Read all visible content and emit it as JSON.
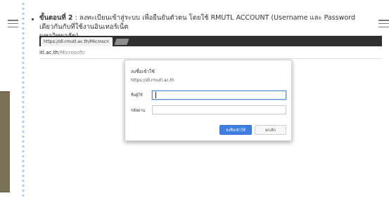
{
  "instruction": {
    "step_label": "ขั้นตอนที่ 2",
    "text_line1": " : ลงทะเบียนเข้าสู่ระบบ เพื่อยืนยันตัวตน โดยใช้ RMUTL ACCOUNT (Username และ Password เดียวกันกับที่ใช้งานอินเทอร์เน็ต",
    "text_line2": "มหาวิทยาลัย)"
  },
  "browser": {
    "tab_title": "https://dl.rmutl.ac.th/Microsc",
    "tab_close": "×",
    "url_host": "itl.ac.th",
    "url_path": "/Microsoft/"
  },
  "dialog": {
    "title": "ลงชื่อเข้าใช้",
    "site": "https://dl.rmutl.ac.th",
    "username_label": "ชื่อผู้ใช้",
    "username_value": "",
    "password_label": "รหัสผ่าน",
    "password_value": "",
    "login_button": "ลงชื่อเข้าใช้",
    "cancel_button": "ยกเลิก"
  },
  "colors": {
    "accent_button": "#3f7fe4",
    "focus_border": "#5b8fd8",
    "tab_bar": "#2f2f2f",
    "side_tab": "#7a7156",
    "dotted_guide": "#9fc6e6"
  },
  "icons": {
    "menu_left": "hamburger-menu-icon",
    "menu_right": "hamburger-menu-icon",
    "new_tab": "new-tab-icon"
  }
}
